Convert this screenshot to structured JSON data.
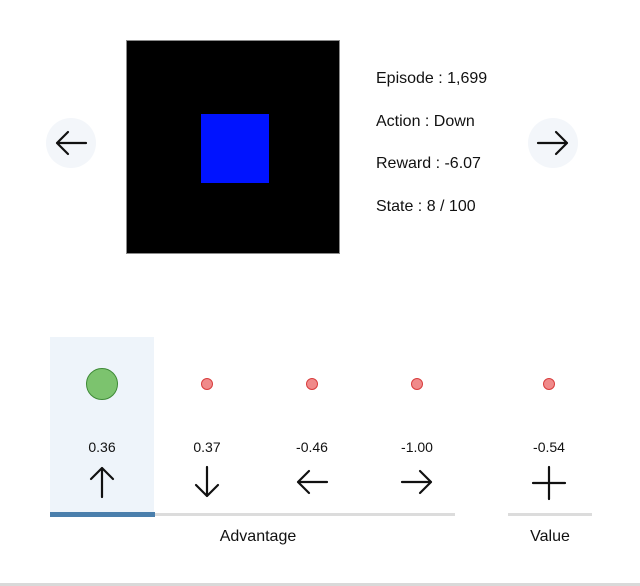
{
  "navigation": {
    "prev_icon": "arrow-left-icon",
    "next_icon": "arrow-right-icon"
  },
  "environment": {
    "background": "#000000",
    "agent_color": "#0013ff"
  },
  "info": {
    "episode": "Episode : 1,699",
    "action": "Action : Down",
    "reward": "Reward : -6.07",
    "state": "State : 8 / 100"
  },
  "actions": [
    {
      "value": "0.36",
      "icon": "arrow-up-icon",
      "selected": true
    },
    {
      "value": "0.37",
      "icon": "arrow-down-icon",
      "selected": false
    },
    {
      "value": "-0.46",
      "icon": "arrow-left-icon",
      "selected": false
    },
    {
      "value": "-1.00",
      "icon": "arrow-right-icon",
      "selected": false
    }
  ],
  "value_column": {
    "value": "-0.54",
    "icon": "plus-icon"
  },
  "labels": {
    "advantage": "Advantage",
    "value": "Value"
  },
  "colors": {
    "selected_dot": "#7cc36e",
    "dot": "#f08a8a",
    "accent": "#4a7fac"
  }
}
